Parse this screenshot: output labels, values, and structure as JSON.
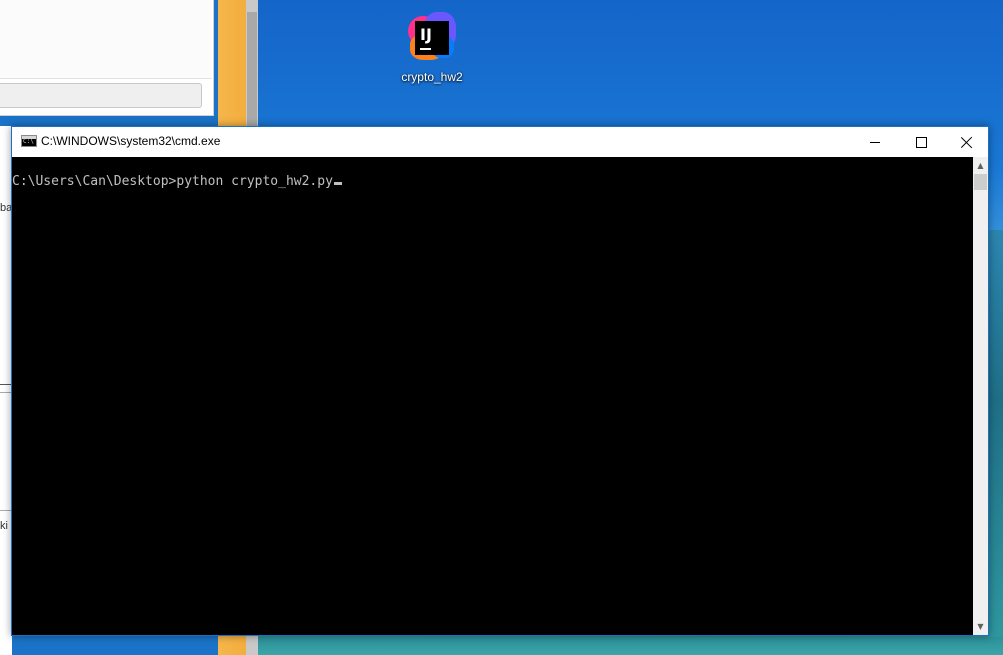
{
  "desktop": {
    "icons": [
      {
        "label": "crypto_hw2",
        "icon": "intellij-idea-icon",
        "logo_text": "IJ"
      }
    ]
  },
  "background_window": {
    "text_fragments": [
      "ba",
      "ki"
    ]
  },
  "cmd_window": {
    "title": "C:\\WINDOWS\\system32\\cmd.exe",
    "icon": "cmd-icon",
    "controls": {
      "minimize": "minimize-icon",
      "maximize": "maximize-icon",
      "close": "close-icon"
    },
    "console": {
      "prompt": "C:\\Users\\Can\\Desktop>",
      "command": "python crypto_hw2.py"
    },
    "colors": {
      "console_bg": "#000000",
      "console_fg": "#c0c0c0",
      "titlebar_bg": "#ffffff",
      "border": "#1e6fbf"
    }
  }
}
